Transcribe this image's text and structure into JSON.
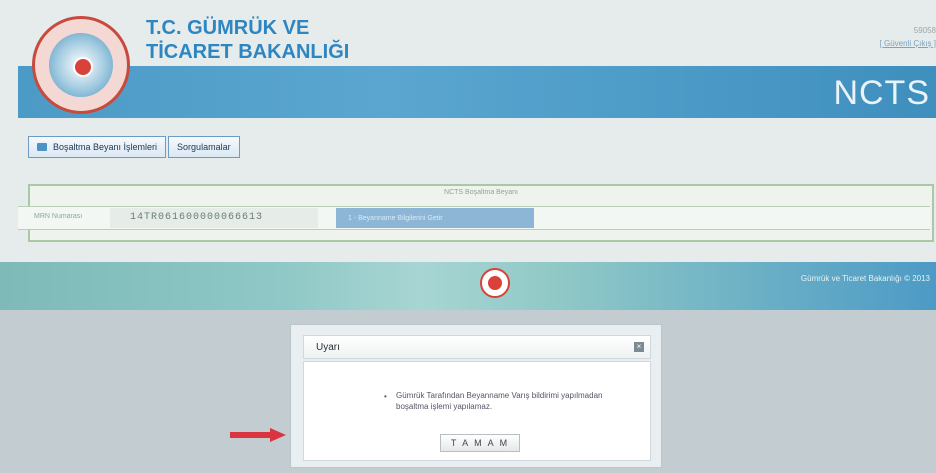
{
  "header": {
    "ministry_line1": "T.C. GÜMRÜK VE",
    "ministry_line2": "TİCARET BAKANLIĞI",
    "system_name": "NCTS",
    "user_id": "59058",
    "logout_link": "[ Güvenli Çıkış ]"
  },
  "nav": {
    "items": [
      {
        "label": "Boşaltma Beyanı İşlemleri"
      },
      {
        "label": "Sorgulamalar"
      }
    ]
  },
  "panel": {
    "title": "NCTS Boşaltma Beyanı",
    "mrn_label": "MRN Numarası",
    "mrn_value": "14TR061600000066613",
    "action_label": "1 - Beyanname Bilgilerini Getir"
  },
  "footer": {
    "text": "Gümrük ve Ticaret Bakanlığı © 2013"
  },
  "dialog": {
    "title": "Uyarı",
    "message": "Gümrük Tarafından Beyanname Varış bildirimi yapılmadan boşaltma işlemi yapılamaz.",
    "ok_label": "T A M A M"
  },
  "colors": {
    "banner_blue": "#4c9ac6",
    "logo_red": "#d8423a",
    "arrow_red": "#d9343f"
  }
}
